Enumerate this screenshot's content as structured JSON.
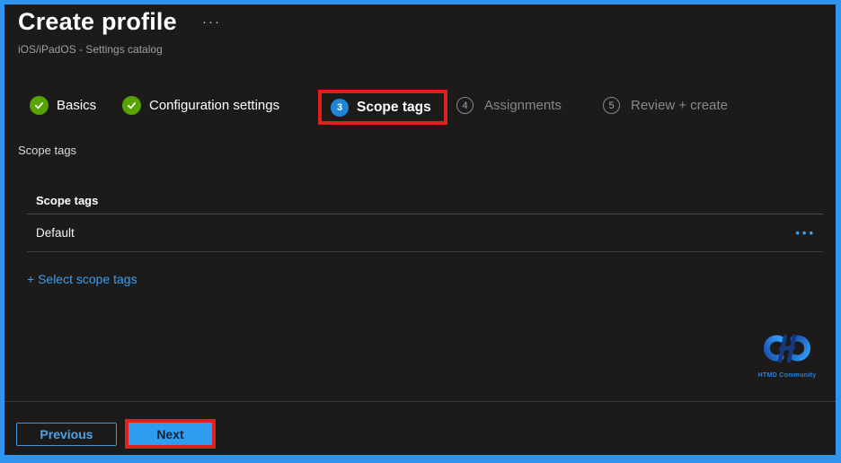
{
  "header": {
    "title": "Create profile",
    "more_label": "···",
    "subtitle": "iOS/iPadOS - Settings catalog"
  },
  "steps": {
    "items": [
      {
        "label": "Basics",
        "state": "complete"
      },
      {
        "label": "Configuration settings",
        "state": "complete"
      },
      {
        "label": "Scope tags",
        "state": "current",
        "number": "3",
        "highlighted": true
      },
      {
        "label": "Assignments",
        "state": "upcoming",
        "number": "4"
      },
      {
        "label": "Review + create",
        "state": "upcoming",
        "number": "5"
      }
    ]
  },
  "content": {
    "section_label": "Scope tags",
    "table": {
      "header": "Scope tags",
      "rows": [
        {
          "value": "Default",
          "menu_icon": "•••"
        }
      ]
    },
    "add_link": "+ Select scope tags"
  },
  "branding": {
    "logo_text": "HTMD Community"
  },
  "footer": {
    "previous_label": "Previous",
    "next_label": "Next"
  },
  "colors": {
    "frame_blue": "#3095ef",
    "background": "#1c1b1a",
    "accent_blue": "#3b9ff0",
    "step_current_blue": "#1e86d8",
    "success_green": "#57a300",
    "highlight_red": "#e0201f",
    "next_button_blue": "#2e9cf0"
  }
}
